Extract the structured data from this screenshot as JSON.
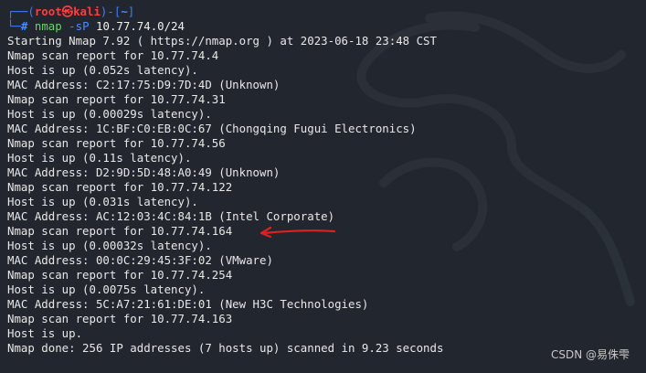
{
  "prompt": {
    "frame_open": "┌──(",
    "user_host": "root㉿kali",
    "frame_mid": ")-[",
    "cwd": "~",
    "frame_close": "]",
    "frame_bottom": "└─",
    "hash": "#"
  },
  "command": {
    "name": "nmap",
    "flag": "-sP",
    "target": "10.77.74.0/24"
  },
  "output_lines": [
    "Starting Nmap 7.92 ( https://nmap.org ) at 2023-06-18 23:48 CST",
    "Nmap scan report for 10.77.74.4",
    "Host is up (0.052s latency).",
    "MAC Address: C2:17:75:D9:7D:4D (Unknown)",
    "Nmap scan report for 10.77.74.31",
    "Host is up (0.00029s latency).",
    "MAC Address: 1C:BF:C0:EB:0C:67 (Chongqing Fugui Electronics)",
    "Nmap scan report for 10.77.74.56",
    "Host is up (0.11s latency).",
    "MAC Address: D2:9D:5D:48:A0:49 (Unknown)",
    "Nmap scan report for 10.77.74.122",
    "Host is up (0.031s latency).",
    "MAC Address: AC:12:03:4C:84:1B (Intel Corporate)",
    "Nmap scan report for 10.77.74.164",
    "Host is up (0.00032s latency).",
    "MAC Address: 00:0C:29:45:3F:02 (VMware)",
    "Nmap scan report for 10.77.74.254",
    "Host is up (0.0075s latency).",
    "MAC Address: 5C:A7:21:61:DE:01 (New H3C Technologies)",
    "Nmap scan report for 10.77.74.163",
    "Host is up.",
    "Nmap done: 256 IP addresses (7 hosts up) scanned in 9.23 seconds"
  ],
  "watermark": "CSDN @易侏雫",
  "colors": {
    "background": "#22262e",
    "annotation_arrow": "#e02020"
  },
  "icons": [
    "kali-dragon-watermark-icon",
    "red-arrow-annotation-icon"
  ]
}
